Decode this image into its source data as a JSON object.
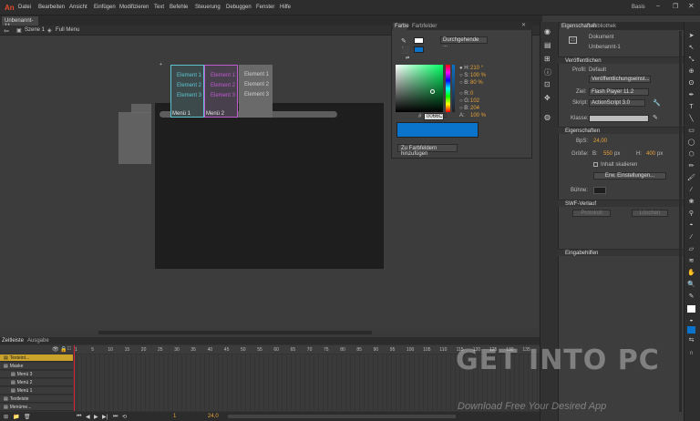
{
  "app": {
    "logo": "An",
    "workspace": "Basis"
  },
  "menu": [
    "Datei",
    "Bearbeiten",
    "Ansicht",
    "Einfügen",
    "Modifizieren",
    "Text",
    "Befehle",
    "Steuerung",
    "Debuggen",
    "Fenster",
    "Hilfe"
  ],
  "doc": {
    "tab": "Unbenannt-1*",
    "scene": "Szene 1",
    "symbol": "Full Menu"
  },
  "stage_menus": [
    {
      "items": [
        "Element 1",
        "Element 2",
        "Element 3"
      ],
      "label": "Menü 1",
      "color": "#5ec3cf"
    },
    {
      "items": [
        "Element 1",
        "Element 2",
        "Element 3"
      ],
      "label": "Menü 2",
      "color": "#c05ad0"
    },
    {
      "items": [
        "Element 1",
        "Element 2",
        "Element 3"
      ],
      "label": "",
      "color": "#9a9a9a"
    }
  ],
  "color_panel": {
    "tab1": "Farbe",
    "tab2": "Farbfelder",
    "fill_type": "Durchgehende ...",
    "H": "210 °",
    "S": "100 %",
    "B": "80 %",
    "R": "0",
    "G": "102",
    "B2": "204",
    "A": "100 %",
    "hex": "0066CC",
    "add_button": "Zu Farbfeldern hinzufügen",
    "hex_label": "#"
  },
  "props": {
    "tab1": "Eigenschaften",
    "tab2": "Bibliothek",
    "doc_label": "Dokument",
    "doc_name": "Unbenannt-1",
    "sec_publish": "Veröffentlichen",
    "profile_label": "Profil:",
    "profile_value": "Default",
    "publish_settings": "Veröffentlichungseinst...",
    "target_label": "Ziel:",
    "target_value": "Flash Player 11.2",
    "script_label": "Skript:",
    "script_value": "ActionScript 3.0",
    "class_label": "Klasse:",
    "sec_props": "Eigenschaften",
    "fps_label": "BpS:",
    "fps_value": "24,00",
    "size_label": "Größe:",
    "w_label": "B:",
    "w_value": "550",
    "h_label": "H:",
    "h_value": "400",
    "px": "px",
    "scale_label": "Inhalt skalieren",
    "advanced": "Erw. Einstellungen...",
    "stage_label": "Bühne:",
    "sec_swf": "SWF-Verlauf",
    "protocol": "Protokoll",
    "clear": "Löschen",
    "sec_accessibility": "Eingabehilfen"
  },
  "timeline": {
    "tab1": "Zeitleiste",
    "tab2": "Ausgabe",
    "frames": [
      "1",
      "5",
      "10",
      "15",
      "20",
      "25",
      "30",
      "35",
      "40",
      "45",
      "50",
      "55",
      "60",
      "65",
      "70",
      "75",
      "80",
      "85",
      "90",
      "95",
      "100",
      "105",
      "110",
      "115",
      "120",
      "125",
      "130",
      "135"
    ],
    "layers": [
      {
        "name": "Texteint...",
        "active": true,
        "indent": 0
      },
      {
        "name": "Maske",
        "active": false,
        "indent": 0
      },
      {
        "name": "Menü 3",
        "active": false,
        "indent": 1
      },
      {
        "name": "Menü 2",
        "active": false,
        "indent": 1
      },
      {
        "name": "Menü 1",
        "active": false,
        "indent": 1
      },
      {
        "name": "Textleiste",
        "active": false,
        "indent": 0
      },
      {
        "name": "Menüme...",
        "active": false,
        "indent": 0
      }
    ],
    "current_frame": "1",
    "fps": "24,0"
  },
  "watermark": {
    "main": "GET INTO PC",
    "sub": "Download Free Your Desired App"
  }
}
